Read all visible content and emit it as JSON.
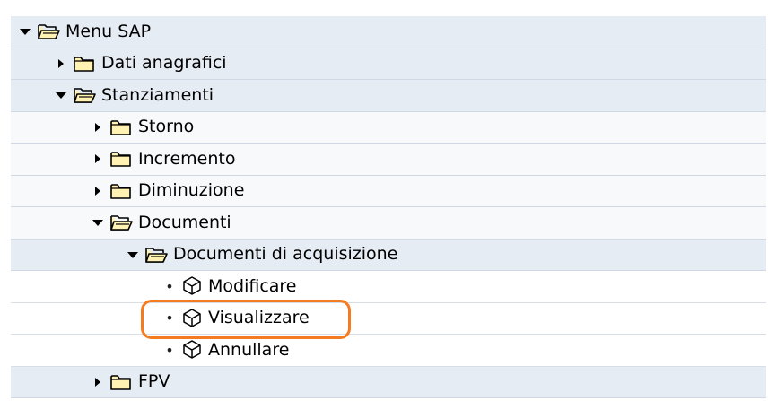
{
  "tree": {
    "root": {
      "label": "Menu SAP"
    },
    "dati_anagrafici": {
      "label": "Dati anagrafici"
    },
    "stanziamenti": {
      "label": "Stanziamenti"
    },
    "storno": {
      "label": "Storno"
    },
    "incremento": {
      "label": "Incremento"
    },
    "diminuzione": {
      "label": "Diminuzione"
    },
    "documenti": {
      "label": "Documenti"
    },
    "documenti_acquisizione": {
      "label": "Documenti di acquisizione"
    },
    "modificare": {
      "label": "Modificare"
    },
    "visualizzare": {
      "label": "Visualizzare"
    },
    "annullare": {
      "label": "Annullare"
    },
    "fpv": {
      "label": "FPV"
    }
  },
  "colors": {
    "highlight": "#f47b20",
    "band_a": "#e6ecf3",
    "band_b": "#f7f9fb"
  }
}
